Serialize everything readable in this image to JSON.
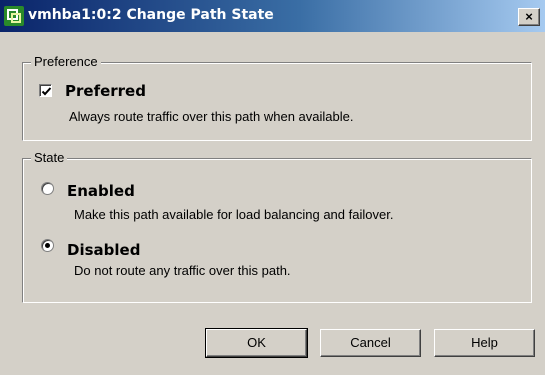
{
  "window": {
    "title": "vmhba1:0:2 Change Path State",
    "close_glyph": "×"
  },
  "preference": {
    "group_label": "Preference",
    "preferred": {
      "label": "Preferred",
      "checked": true,
      "description": "Always route traffic over this path when available."
    }
  },
  "state": {
    "group_label": "State",
    "enabled": {
      "label": "Enabled",
      "selected": false,
      "description": "Make this path available for load balancing and failover."
    },
    "disabled": {
      "label": "Disabled",
      "selected": true,
      "description": "Do not route any traffic over this path."
    }
  },
  "buttons": {
    "ok": "OK",
    "cancel": "Cancel",
    "help": "Help"
  },
  "icons": {
    "app": "vmware-app-icon",
    "close": "close-icon"
  }
}
